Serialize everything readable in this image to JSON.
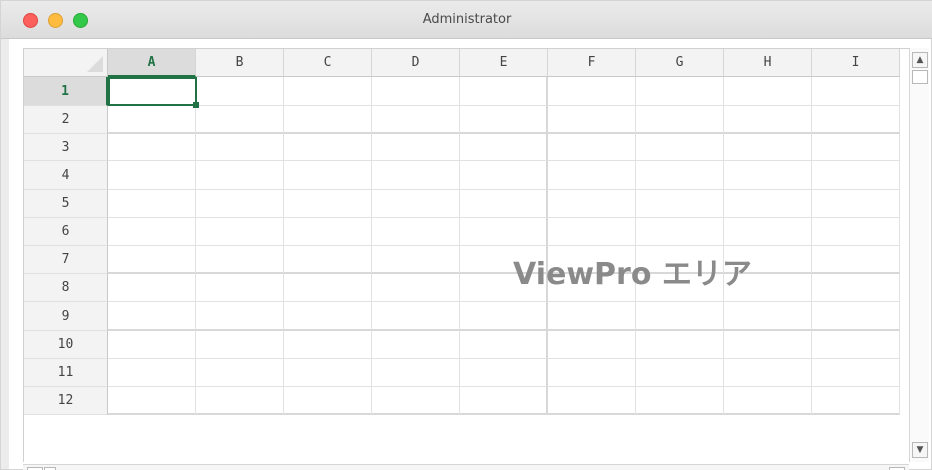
{
  "window": {
    "title": "Administrator"
  },
  "sheet": {
    "columns": [
      "A",
      "B",
      "C",
      "D",
      "E",
      "F",
      "G",
      "H",
      "I"
    ],
    "rows": [
      "1",
      "2",
      "3",
      "4",
      "5",
      "6",
      "7",
      "8",
      "9",
      "10",
      "11",
      "12"
    ],
    "active_cell": "A1"
  },
  "overlay": {
    "label": "ViewPro エリア"
  },
  "scrollbars": {
    "up_icon": "triangle-up-icon",
    "down_icon": "triangle-down-icon",
    "left_icon": "triangle-left-icon",
    "right_icon": "triangle-right-icon"
  },
  "colors": {
    "selection": "#217346",
    "close": "#fc605c",
    "minimize": "#fdbc40",
    "zoom": "#34c84a"
  }
}
